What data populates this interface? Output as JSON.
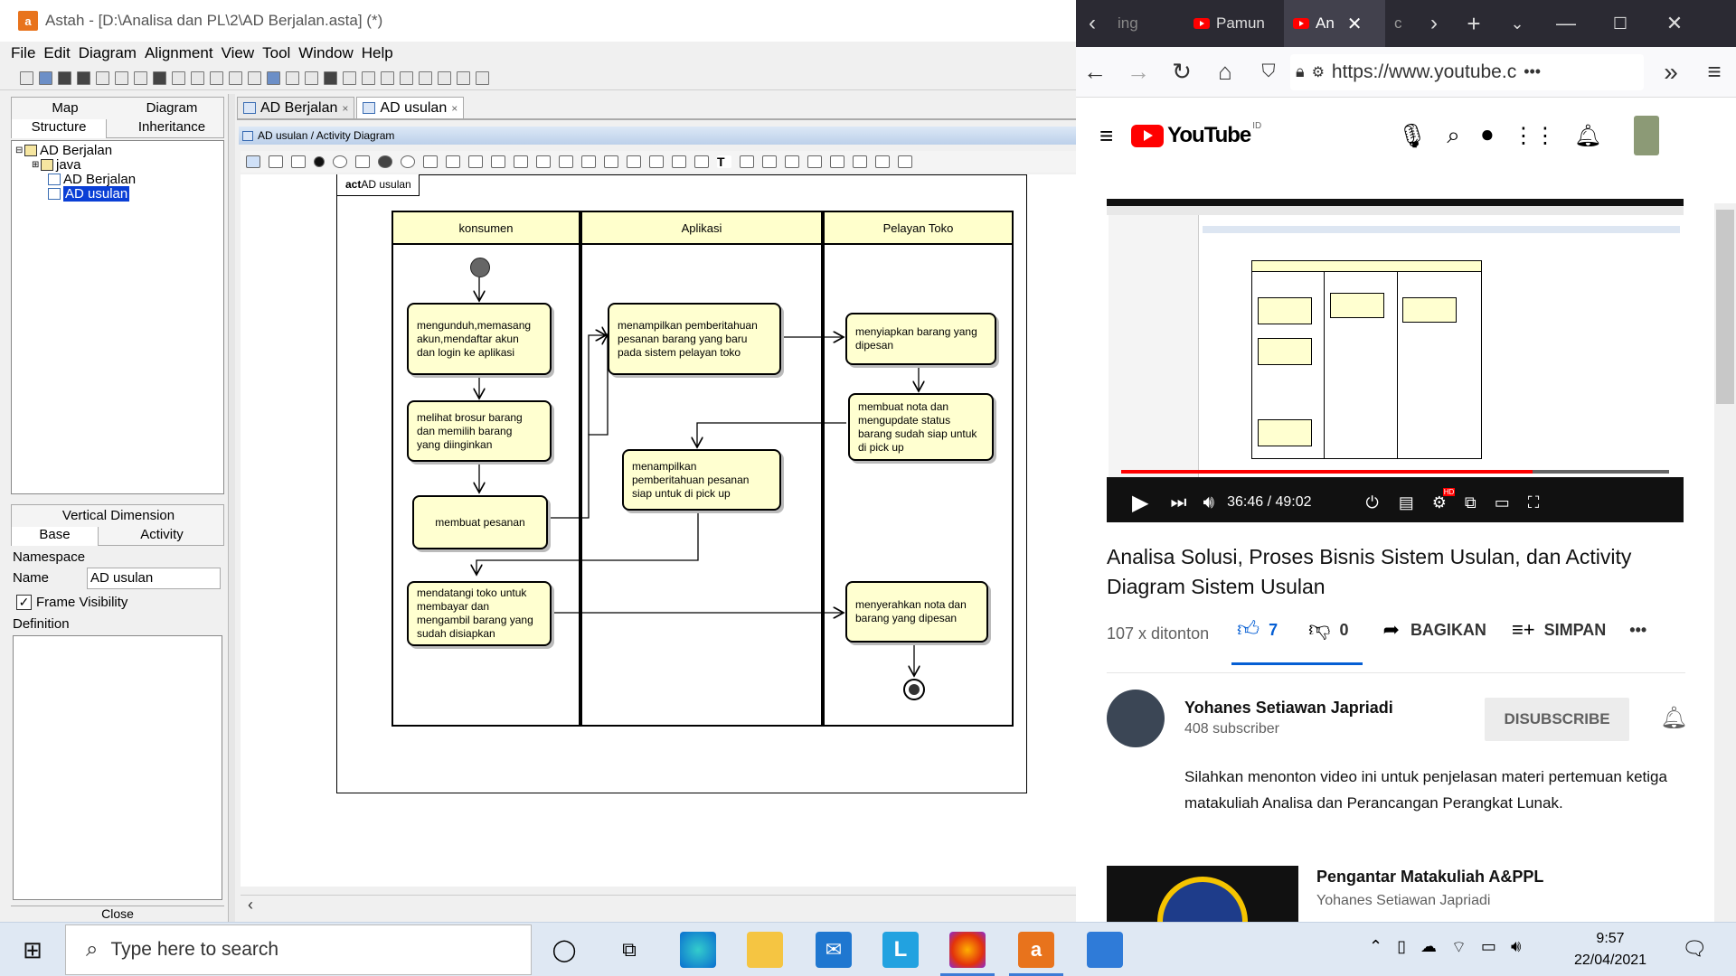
{
  "astah": {
    "title": "Astah - [D:\\Analisa dan PL\\2\\AD Berjalan.asta] (*)",
    "logo": "a",
    "menu": [
      "File",
      "Edit",
      "Diagram",
      "Alignment",
      "View",
      "Tool",
      "Window",
      "Help"
    ],
    "left_tabs": {
      "map": "Map",
      "diagram": "Diagram",
      "structure": "Structure",
      "inheritance": "Inheritance"
    },
    "tree": [
      {
        "label": "AD Berjalan",
        "icon": "folder-icon"
      },
      {
        "label": "java",
        "icon": "folder-icon"
      },
      {
        "label": "AD Berjalan",
        "icon": "diagram-icon"
      },
      {
        "label": "AD usulan",
        "icon": "diagram-icon",
        "selected": true
      }
    ],
    "props_tabs": {
      "vertical": "Vertical Dimension",
      "base": "Base",
      "activity": "Activity"
    },
    "props": {
      "namespace": "Namespace",
      "name_label": "Name",
      "name_value": "AD usulan",
      "frame_visibility": "Frame Visibility",
      "definition": "Definition"
    },
    "close": "Close",
    "editor_tabs": [
      {
        "label": "AD Berjalan",
        "active": false
      },
      {
        "label": "AD usulan",
        "active": true
      }
    ],
    "tab_close": "×",
    "path": "AD usulan / Activity Diagram",
    "frame_tag_kw": "act",
    "frame_tag_name": "AD usulan",
    "lanes": [
      "konsumen",
      "Aplikasi",
      "Pelayan Toko"
    ],
    "activities": {
      "a1": "mengunduh,memasang\nakun,mendaftar  akun\ndan login ke aplikasi",
      "a2": "melihat brosur barang\ndan memilih barang\nyang diinginkan",
      "a3": "membuat pesanan",
      "a4": "mendatangi toko untuk\nmembayar dan\nmengambil barang yang\nsudah disiapkan",
      "b1": "menampilkan pemberitahuan\npesanan barang yang baru\npada sistem pelayan toko",
      "b2": "menampilkan\npemberitahuan pesanan\nsiap untuk di pick up",
      "c1": "menyiapkan barang yang\ndipesan",
      "c2": "membuat nota dan\nmengupdate status\nbarang sudah siap untuk\ndi pick up",
      "c3": "menyerahkan nota dan\nbarang yang dipesan"
    }
  },
  "firefox": {
    "tabs": [
      {
        "label": "ing",
        "icon": ""
      },
      {
        "label": "Pamun",
        "icon": "youtube-favicon"
      },
      {
        "label": "An",
        "icon": "youtube-favicon",
        "active": true
      },
      {
        "label": "c",
        "icon": ""
      }
    ],
    "url": "https://www.youtube.c",
    "url_more": "•••"
  },
  "youtube": {
    "brand": "YouTube",
    "region": "ID",
    "time": "36:46 / 49:02",
    "progress": 0.75,
    "title": "Analisa Solusi, Proses Bisnis Sistem Usulan, dan Activity Diagram Sistem Usulan",
    "views": "107 x ditonton",
    "likes": "7",
    "dislikes": "0",
    "share": "BAGIKAN",
    "save": "SIMPAN",
    "more": "•••",
    "channel": "Yohanes Setiawan Japriadi",
    "subscribers": "408 subscriber",
    "subscribe_btn": "DISUBSCRIBE",
    "description": "Silahkan menonton video ini untuk penjelasan materi pertemuan ketiga matakuliah Analisa dan Perancangan Perangkat Lunak.",
    "next_title": "Pengantar Matakuliah A&PPL",
    "next_channel": "Yohanes Setiawan Japriadi",
    "hd": "HD"
  },
  "taskbar": {
    "search_placeholder": "Type here to search",
    "time": "9:57",
    "date": "22/04/2021"
  },
  "colors": {
    "accent": "#e8731c",
    "yt_red": "#ff0000",
    "lane_head": "#ffffcc",
    "activity": "#ffffd0",
    "like_blue": "#065fd4"
  }
}
